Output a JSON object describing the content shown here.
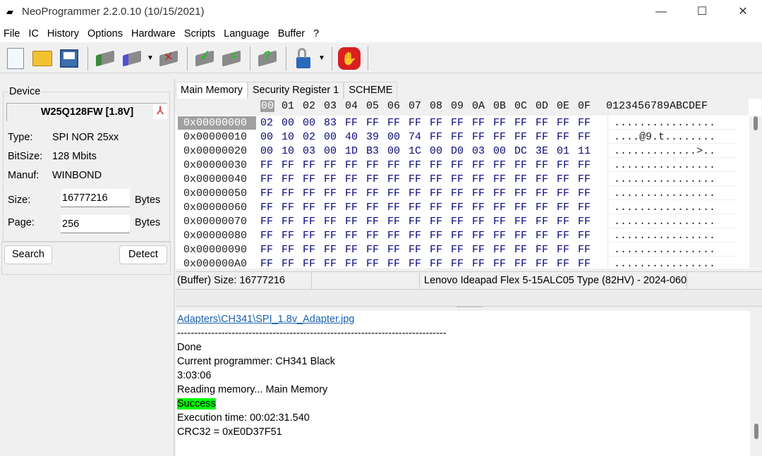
{
  "title": "NeoProgrammer 2.2.0.10 (10/15/2021)",
  "menu": [
    "File",
    "IC",
    "History",
    "Options",
    "Hardware",
    "Scripts",
    "Language",
    "Buffer",
    "?"
  ],
  "toolbar_icons": [
    "new-file-icon",
    "open-folder-icon",
    "save-icon",
    "read-chip-icon",
    "write-chip-icon",
    "erase-chip-icon",
    "verify-chip-icon",
    "blank-check-icon",
    "auto-detect-icon",
    "lock-icon",
    "stop-icon"
  ],
  "device": {
    "legend": "Device",
    "name": "W25Q128FW [1.8V]",
    "fields": [
      {
        "label": "Type:",
        "value": "SPI NOR 25xx"
      },
      {
        "label": "BitSize:",
        "value": "128 Mbits"
      },
      {
        "label": "Manuf:",
        "value": "WINBOND"
      }
    ],
    "size_label": "Size:",
    "size_value": "16777216",
    "size_unit": "Bytes",
    "page_label": "Page:",
    "page_value": "256",
    "page_unit": "Bytes",
    "search": "Search",
    "detect": "Detect"
  },
  "tabs": [
    "Main Memory",
    "Security Register 1",
    "SCHEME"
  ],
  "hex": {
    "columns": [
      "00",
      "01",
      "02",
      "03",
      "04",
      "05",
      "06",
      "07",
      "08",
      "09",
      "0A",
      "0B",
      "0C",
      "0D",
      "0E",
      "0F"
    ],
    "ascii_header": "0123456789ABCDEF",
    "rows": [
      {
        "addr": "0x00000000",
        "bytes": "02 00 00 83 FF FF FF FF FF FF FF FF FF FF FF FF",
        "ascii": "................"
      },
      {
        "addr": "0x00000010",
        "bytes": "00 10 02 00 40 39 00 74 FF FF FF FF FF FF FF FF",
        "ascii": "....@9.t........"
      },
      {
        "addr": "0x00000020",
        "bytes": "00 10 03 00 1D B3 00 1C 00 D0 03 00 DC 3E 01 11",
        "ascii": ".............>.."
      },
      {
        "addr": "0x00000030",
        "bytes": "FF FF FF FF FF FF FF FF FF FF FF FF FF FF FF FF",
        "ascii": "................"
      },
      {
        "addr": "0x00000040",
        "bytes": "FF FF FF FF FF FF FF FF FF FF FF FF FF FF FF FF",
        "ascii": "................"
      },
      {
        "addr": "0x00000050",
        "bytes": "FF FF FF FF FF FF FF FF FF FF FF FF FF FF FF FF",
        "ascii": "................"
      },
      {
        "addr": "0x00000060",
        "bytes": "FF FF FF FF FF FF FF FF FF FF FF FF FF FF FF FF",
        "ascii": "................"
      },
      {
        "addr": "0x00000070",
        "bytes": "FF FF FF FF FF FF FF FF FF FF FF FF FF FF FF FF",
        "ascii": "................"
      },
      {
        "addr": "0x00000080",
        "bytes": "FF FF FF FF FF FF FF FF FF FF FF FF FF FF FF FF",
        "ascii": "................"
      },
      {
        "addr": "0x00000090",
        "bytes": "FF FF FF FF FF FF FF FF FF FF FF FF FF FF FF FF",
        "ascii": "................"
      },
      {
        "addr": "0x000000A0",
        "bytes": "FF FF FF FF FF FF FF FF FF FF FF FF FF FF FF FF",
        "ascii": "................"
      }
    ]
  },
  "status": {
    "buffer_size": "(Buffer) Size: 16777216",
    "description": "Lenovo Ideapad Flex 5-15ALC05 Type (82HV) - 2024-060"
  },
  "log": {
    "link": "Adapters\\CH341\\SPI_1.8v_Adapter.jpg",
    "separator": "-------------------------------------------------------------------------------",
    "lines": [
      "Done",
      "Current programmer: CH341 Black",
      "3:03:06",
      "Reading memory... Main Memory"
    ],
    "success": "Success",
    "after": [
      "Execution time: 00:02:31.540",
      "CRC32 = 0xE0D37F51"
    ]
  }
}
